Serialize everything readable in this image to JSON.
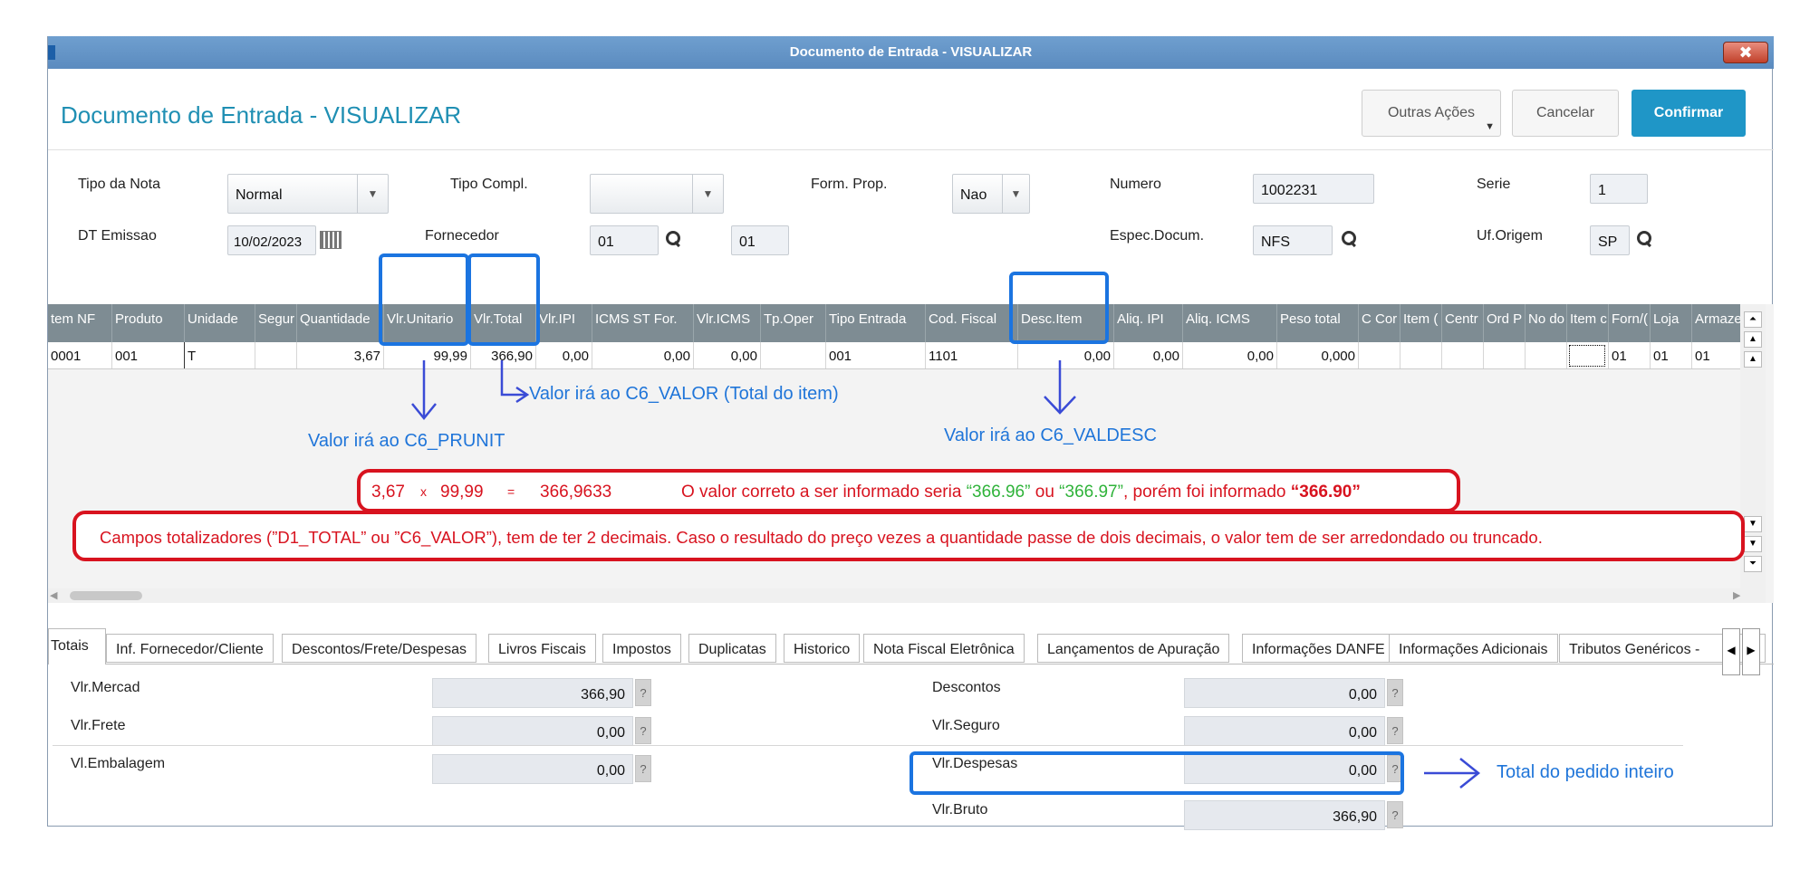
{
  "window": {
    "title": "Documento de Entrada - VISUALIZAR",
    "close_label": "✖"
  },
  "header": {
    "title": "Documento de Entrada - VISUALIZAR",
    "buttons": {
      "outras_acoes": "Outras Ações",
      "cancelar": "Cancelar",
      "confirmar": "Confirmar"
    }
  },
  "form": {
    "tipo_nota": {
      "label": "Tipo da Nota",
      "value": "Normal"
    },
    "tipo_compl": {
      "label": "Tipo Compl.",
      "value": ""
    },
    "form_prop": {
      "label": "Form. Prop.",
      "value": "Nao"
    },
    "numero": {
      "label": "Numero",
      "value": "1002231"
    },
    "serie": {
      "label": "Serie",
      "value": "1"
    },
    "dt_emissao": {
      "label": "DT Emissao",
      "value": "10/02/2023"
    },
    "fornecedor": {
      "label": "Fornecedor",
      "code": "01",
      "loja": "01"
    },
    "espec_docum": {
      "label": "Espec.Docum.",
      "value": "NFS"
    },
    "uf_origem": {
      "label": "Uf.Origem",
      "value": "SP"
    }
  },
  "grid": {
    "headers": [
      "tem NF",
      "Produto",
      "Unidade",
      "Segur",
      "Quantidade",
      "Vlr.Unitario",
      "Vlr.Total",
      "Vlr.IPI",
      "ICMS ST For.",
      "Vlr.ICMS",
      "Tp.Oper",
      "Tipo Entrada",
      "Cod. Fiscal",
      "Desc.Item",
      "Aliq. IPI",
      "Aliq. ICMS",
      "Peso total",
      "C Cor",
      "Item (",
      "Centr",
      "Ord P",
      "No do",
      "Item c",
      "Forn/(",
      "Loja",
      "Armazen"
    ],
    "row": [
      "0001",
      "001",
      "T",
      "",
      "3,67",
      "99,99",
      "366,90",
      "0,00",
      "0,00",
      "0,00",
      "",
      "001",
      "1101",
      "0,00",
      "0,00",
      "0,00",
      "0,000",
      "",
      "",
      "",
      "",
      "",
      "",
      "01",
      "01",
      "01"
    ]
  },
  "annotations": {
    "prunit": "Valor irá ao C6_PRUNIT",
    "valor": "Valor irá ao C6_VALOR (Total do item)",
    "valdesc": "Valor irá ao C6_VALDESC",
    "calc": {
      "qty": "3,67",
      "times": "x",
      "price": "99,99",
      "equals": "=",
      "result": "366,9633"
    },
    "correct_1": "O valor correto a ser informado seria ",
    "correct_v1": "“366.96”",
    "correct_2": " ou ",
    "correct_v2": "“366.97”",
    "correct_3": ", porém foi informado ",
    "correct_v3": "“366.90”",
    "rule": "Campos totalizadores (”D1_TOTAL” ou ”C6_VALOR”), tem de ter 2 decimais. Caso o resultado do preço vezes a quantidade passe de dois decimais, o valor tem de ser arredondado ou truncado.",
    "total_pedido": "Total do pedido inteiro"
  },
  "tabs": [
    "Totais",
    "Inf. Fornecedor/Cliente",
    "Descontos/Frete/Despesas",
    "Livros Fiscais",
    "Impostos",
    "Duplicatas",
    "Historico",
    "Nota Fiscal Eletrônica",
    "Lançamentos de Apuração",
    "Informações DANFE",
    "Informações Adicionais",
    "Tributos Genéricos -"
  ],
  "totals": {
    "vlr_mercad": {
      "label": "Vlr.Mercad",
      "value": "366,90"
    },
    "vlr_frete": {
      "label": "Vlr.Frete",
      "value": "0,00"
    },
    "vl_embalagem": {
      "label": "Vl.Embalagem",
      "value": "0,00"
    },
    "descontos": {
      "label": "Descontos",
      "value": "0,00"
    },
    "vlr_seguro": {
      "label": "Vlr.Seguro",
      "value": "0,00"
    },
    "vlr_despesas": {
      "label": "Vlr.Despesas",
      "value": "0,00"
    },
    "vlr_bruto": {
      "label": "Vlr.Bruto",
      "value": "366,90"
    },
    "help": "?"
  },
  "colors": {
    "accent": "#1f96c7",
    "annotation_blue": "#1f75d9",
    "annotation_red": "#d8131f",
    "annotation_green": "#2fb33a",
    "grid_header": "#7e8c93"
  }
}
